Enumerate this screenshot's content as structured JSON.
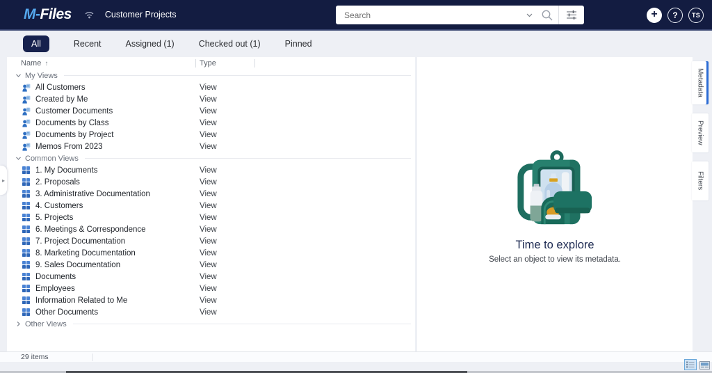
{
  "header": {
    "logo_part1": "M-",
    "logo_part2": "Files",
    "vault_name": "Customer Projects",
    "search_placeholder": "Search",
    "add_label": "+",
    "help_label": "?",
    "user_initials": "TS"
  },
  "tabs": [
    {
      "label": "All",
      "active": true
    },
    {
      "label": "Recent",
      "active": false
    },
    {
      "label": "Assigned (1)",
      "active": false
    },
    {
      "label": "Checked out (1)",
      "active": false
    },
    {
      "label": "Pinned",
      "active": false
    }
  ],
  "list": {
    "columns": [
      {
        "label": "Name",
        "sort": "asc",
        "sort_glyph": "↑"
      },
      {
        "label": "Type"
      }
    ],
    "groups": [
      {
        "label": "My Views",
        "expanded": true,
        "icon": "personal-view-icon",
        "items": [
          {
            "name": "All Customers",
            "type": "View"
          },
          {
            "name": "Created by Me",
            "type": "View"
          },
          {
            "name": "Customer Documents",
            "type": "View"
          },
          {
            "name": "Documents by Class",
            "type": "View"
          },
          {
            "name": "Documents by Project",
            "type": "View"
          },
          {
            "name": "Memos From 2023",
            "type": "View"
          }
        ]
      },
      {
        "label": "Common Views",
        "expanded": true,
        "icon": "common-view-icon",
        "items": [
          {
            "name": "1. My Documents",
            "type": "View"
          },
          {
            "name": "2. Proposals",
            "type": "View"
          },
          {
            "name": "3. Administrative Documentation",
            "type": "View"
          },
          {
            "name": "4. Customers",
            "type": "View"
          },
          {
            "name": "5. Projects",
            "type": "View"
          },
          {
            "name": "6. Meetings & Correspondence",
            "type": "View"
          },
          {
            "name": "7. Project Documentation",
            "type": "View"
          },
          {
            "name": "8. Marketing Documentation",
            "type": "View"
          },
          {
            "name": "9. Sales Documentation",
            "type": "View"
          },
          {
            "name": "Documents",
            "type": "View"
          },
          {
            "name": "Employees",
            "type": "View"
          },
          {
            "name": "Information Related to Me",
            "type": "View"
          },
          {
            "name": "Other Documents",
            "type": "View"
          }
        ]
      },
      {
        "label": "Other Views",
        "expanded": false,
        "icon": "common-view-icon",
        "items": []
      }
    ]
  },
  "metadata_panel": {
    "illustration": "backpack-illustration",
    "title": "Time to explore",
    "subtitle": "Select an object to view its metadata."
  },
  "side_tabs": [
    {
      "label": "Metadata",
      "active": true
    },
    {
      "label": "Preview",
      "active": false
    },
    {
      "label": "Filters",
      "active": false
    }
  ],
  "status_bar": {
    "items_count": "29 items"
  },
  "icons": {
    "header": [
      "wifi-icon",
      "search-chevron-icon",
      "magnifier-icon",
      "filter-sliders-icon",
      "plus-icon",
      "help-icon"
    ],
    "bottom": [
      "details-view-icon",
      "thumbnails-view-icon"
    ],
    "left_edge": "flyout-expander-icon"
  },
  "colors": {
    "header_bg": "#131c41",
    "header_accent": "#36426d",
    "active_tab_bg": "#16214d",
    "side_tab_accent": "#2a6bd4",
    "view_icon_blue": "#3b76c9",
    "illustration_teal": "#27806e",
    "background": "#eef0f5"
  }
}
